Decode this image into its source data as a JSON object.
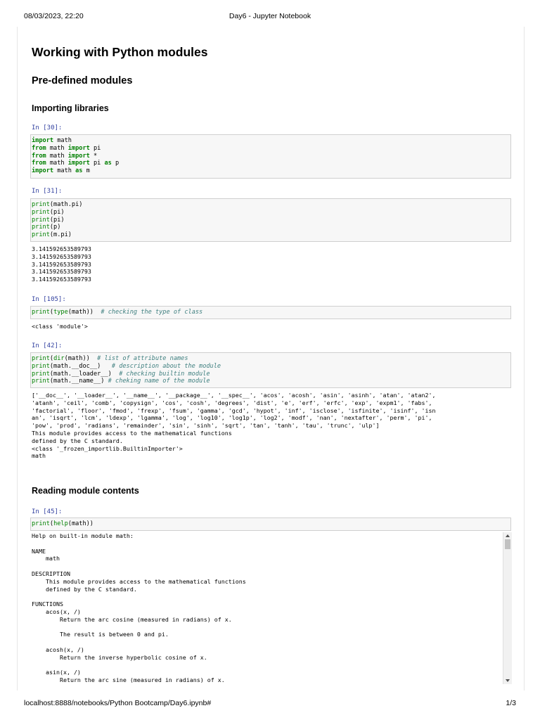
{
  "print_header": {
    "date": "08/03/2023, 22:20",
    "title": "Day6 - Jupyter Notebook"
  },
  "print_footer": {
    "url": "localhost:8888/notebooks/Python Bootcamp/Day6.ipynb#",
    "pages": "1/3"
  },
  "headings": {
    "h1": "Working with Python modules",
    "h2": "Pre-defined modules",
    "h3_import": "Importing libraries",
    "h3_reading": "Reading module contents"
  },
  "cells": [
    {
      "prompt": "In [30]:",
      "code": [
        [
          [
            "kw",
            "import"
          ],
          [
            "t",
            " math"
          ]
        ],
        [
          [
            "kw",
            "from"
          ],
          [
            "t",
            " math "
          ],
          [
            "kw",
            "import"
          ],
          [
            "t",
            " pi"
          ]
        ],
        [
          [
            "kw",
            "from"
          ],
          [
            "t",
            " math "
          ],
          [
            "kw",
            "import"
          ],
          [
            "t",
            " *"
          ]
        ],
        [
          [
            "kw",
            "from"
          ],
          [
            "t",
            " math "
          ],
          [
            "kw",
            "import"
          ],
          [
            "t",
            " pi "
          ],
          [
            "kw",
            "as"
          ],
          [
            "t",
            " p"
          ]
        ],
        [
          [
            "kw",
            "import"
          ],
          [
            "t",
            " math "
          ],
          [
            "kw",
            "as"
          ],
          [
            "t",
            " m"
          ]
        ]
      ],
      "output": []
    },
    {
      "prompt": "In [31]:",
      "code": [
        [
          [
            "bi",
            "print"
          ],
          [
            "t",
            "(math.pi)"
          ]
        ],
        [
          [
            "bi",
            "print"
          ],
          [
            "t",
            "(pi)"
          ]
        ],
        [
          [
            "bi",
            "print"
          ],
          [
            "t",
            "(pi)"
          ]
        ],
        [
          [
            "bi",
            "print"
          ],
          [
            "t",
            "(p)"
          ]
        ],
        [
          [
            "bi",
            "print"
          ],
          [
            "t",
            "(m.pi)"
          ]
        ]
      ],
      "output": [
        "3.141592653589793",
        "3.141592653589793",
        "3.141592653589793",
        "3.141592653589793",
        "3.141592653589793"
      ]
    },
    {
      "prompt": "In [105]:",
      "code": [
        [
          [
            "bi",
            "print"
          ],
          [
            "t",
            "("
          ],
          [
            "bi",
            "type"
          ],
          [
            "t",
            "(math))  "
          ],
          [
            "cm",
            "# checking the type of class"
          ]
        ]
      ],
      "output": [
        "<class 'module'>"
      ]
    },
    {
      "prompt": "In [42]:",
      "code": [
        [
          [
            "bi",
            "print"
          ],
          [
            "t",
            "("
          ],
          [
            "bi",
            "dir"
          ],
          [
            "t",
            "(math))  "
          ],
          [
            "cm",
            "# list of attribute names"
          ]
        ],
        [
          [
            "bi",
            "print"
          ],
          [
            "t",
            "(math.__doc__)   "
          ],
          [
            "cm",
            "# description about the module"
          ]
        ],
        [
          [
            "bi",
            "print"
          ],
          [
            "t",
            "(math.__loader__)  "
          ],
          [
            "cm",
            "# checking builtin module"
          ]
        ],
        [
          [
            "bi",
            "print"
          ],
          [
            "t",
            "(math.__name__) "
          ],
          [
            "cm",
            "# cheking name of the module"
          ]
        ]
      ],
      "output": [
        "['__doc__', '__loader__', '__name__', '__package__', '__spec__', 'acos', 'acosh', 'asin', 'asinh', 'atan', 'atan2',",
        "'atanh', 'ceil', 'comb', 'copysign', 'cos', 'cosh', 'degrees', 'dist', 'e', 'erf', 'erfc', 'exp', 'expm1', 'fabs',",
        "'factorial', 'floor', 'fmod', 'frexp', 'fsum', 'gamma', 'gcd', 'hypot', 'inf', 'isclose', 'isfinite', 'isinf', 'isn",
        "an', 'isqrt', 'lcm', 'ldexp', 'lgamma', 'log', 'log10', 'log1p', 'log2', 'modf', 'nan', 'nextafter', 'perm', 'pi',",
        "'pow', 'prod', 'radians', 'remainder', 'sin', 'sinh', 'sqrt', 'tan', 'tanh', 'tau', 'trunc', 'ulp']",
        "This module provides access to the mathematical functions",
        "defined by the C standard.",
        "<class '_frozen_importlib.BuiltinImporter'>",
        "math"
      ]
    },
    {
      "prompt": "In [45]:",
      "code": [
        [
          [
            "bi",
            "print"
          ],
          [
            "t",
            "("
          ],
          [
            "bi",
            "help"
          ],
          [
            "t",
            "(math))"
          ]
        ]
      ],
      "output": [
        "Help on built-in module math:",
        "",
        "NAME",
        "    math",
        "",
        "DESCRIPTION",
        "    This module provides access to the mathematical functions",
        "    defined by the C standard.",
        "",
        "FUNCTIONS",
        "    acos(x, /)",
        "        Return the arc cosine (measured in radians) of x.",
        "",
        "        The result is between 0 and pi.",
        "",
        "    acosh(x, /)",
        "        Return the inverse hyperbolic cosine of x.",
        "",
        "    asin(x, /)",
        "        Return the arc sine (measured in radians) of x."
      ]
    }
  ]
}
